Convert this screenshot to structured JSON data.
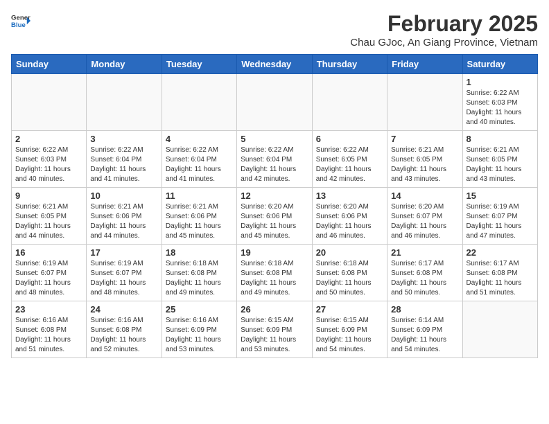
{
  "logo": {
    "general": "General",
    "blue": "Blue"
  },
  "header": {
    "month": "February 2025",
    "location": "Chau GJoc, An Giang Province, Vietnam"
  },
  "weekdays": [
    "Sunday",
    "Monday",
    "Tuesday",
    "Wednesday",
    "Thursday",
    "Friday",
    "Saturday"
  ],
  "weeks": [
    [
      {
        "day": "",
        "info": ""
      },
      {
        "day": "",
        "info": ""
      },
      {
        "day": "",
        "info": ""
      },
      {
        "day": "",
        "info": ""
      },
      {
        "day": "",
        "info": ""
      },
      {
        "day": "",
        "info": ""
      },
      {
        "day": "1",
        "info": "Sunrise: 6:22 AM\nSunset: 6:03 PM\nDaylight: 11 hours\nand 40 minutes."
      }
    ],
    [
      {
        "day": "2",
        "info": "Sunrise: 6:22 AM\nSunset: 6:03 PM\nDaylight: 11 hours\nand 40 minutes."
      },
      {
        "day": "3",
        "info": "Sunrise: 6:22 AM\nSunset: 6:04 PM\nDaylight: 11 hours\nand 41 minutes."
      },
      {
        "day": "4",
        "info": "Sunrise: 6:22 AM\nSunset: 6:04 PM\nDaylight: 11 hours\nand 41 minutes."
      },
      {
        "day": "5",
        "info": "Sunrise: 6:22 AM\nSunset: 6:04 PM\nDaylight: 11 hours\nand 42 minutes."
      },
      {
        "day": "6",
        "info": "Sunrise: 6:22 AM\nSunset: 6:05 PM\nDaylight: 11 hours\nand 42 minutes."
      },
      {
        "day": "7",
        "info": "Sunrise: 6:21 AM\nSunset: 6:05 PM\nDaylight: 11 hours\nand 43 minutes."
      },
      {
        "day": "8",
        "info": "Sunrise: 6:21 AM\nSunset: 6:05 PM\nDaylight: 11 hours\nand 43 minutes."
      }
    ],
    [
      {
        "day": "9",
        "info": "Sunrise: 6:21 AM\nSunset: 6:05 PM\nDaylight: 11 hours\nand 44 minutes."
      },
      {
        "day": "10",
        "info": "Sunrise: 6:21 AM\nSunset: 6:06 PM\nDaylight: 11 hours\nand 44 minutes."
      },
      {
        "day": "11",
        "info": "Sunrise: 6:21 AM\nSunset: 6:06 PM\nDaylight: 11 hours\nand 45 minutes."
      },
      {
        "day": "12",
        "info": "Sunrise: 6:20 AM\nSunset: 6:06 PM\nDaylight: 11 hours\nand 45 minutes."
      },
      {
        "day": "13",
        "info": "Sunrise: 6:20 AM\nSunset: 6:06 PM\nDaylight: 11 hours\nand 46 minutes."
      },
      {
        "day": "14",
        "info": "Sunrise: 6:20 AM\nSunset: 6:07 PM\nDaylight: 11 hours\nand 46 minutes."
      },
      {
        "day": "15",
        "info": "Sunrise: 6:19 AM\nSunset: 6:07 PM\nDaylight: 11 hours\nand 47 minutes."
      }
    ],
    [
      {
        "day": "16",
        "info": "Sunrise: 6:19 AM\nSunset: 6:07 PM\nDaylight: 11 hours\nand 48 minutes."
      },
      {
        "day": "17",
        "info": "Sunrise: 6:19 AM\nSunset: 6:07 PM\nDaylight: 11 hours\nand 48 minutes."
      },
      {
        "day": "18",
        "info": "Sunrise: 6:18 AM\nSunset: 6:08 PM\nDaylight: 11 hours\nand 49 minutes."
      },
      {
        "day": "19",
        "info": "Sunrise: 6:18 AM\nSunset: 6:08 PM\nDaylight: 11 hours\nand 49 minutes."
      },
      {
        "day": "20",
        "info": "Sunrise: 6:18 AM\nSunset: 6:08 PM\nDaylight: 11 hours\nand 50 minutes."
      },
      {
        "day": "21",
        "info": "Sunrise: 6:17 AM\nSunset: 6:08 PM\nDaylight: 11 hours\nand 50 minutes."
      },
      {
        "day": "22",
        "info": "Sunrise: 6:17 AM\nSunset: 6:08 PM\nDaylight: 11 hours\nand 51 minutes."
      }
    ],
    [
      {
        "day": "23",
        "info": "Sunrise: 6:16 AM\nSunset: 6:08 PM\nDaylight: 11 hours\nand 51 minutes."
      },
      {
        "day": "24",
        "info": "Sunrise: 6:16 AM\nSunset: 6:08 PM\nDaylight: 11 hours\nand 52 minutes."
      },
      {
        "day": "25",
        "info": "Sunrise: 6:16 AM\nSunset: 6:09 PM\nDaylight: 11 hours\nand 53 minutes."
      },
      {
        "day": "26",
        "info": "Sunrise: 6:15 AM\nSunset: 6:09 PM\nDaylight: 11 hours\nand 53 minutes."
      },
      {
        "day": "27",
        "info": "Sunrise: 6:15 AM\nSunset: 6:09 PM\nDaylight: 11 hours\nand 54 minutes."
      },
      {
        "day": "28",
        "info": "Sunrise: 6:14 AM\nSunset: 6:09 PM\nDaylight: 11 hours\nand 54 minutes."
      },
      {
        "day": "",
        "info": ""
      }
    ]
  ]
}
